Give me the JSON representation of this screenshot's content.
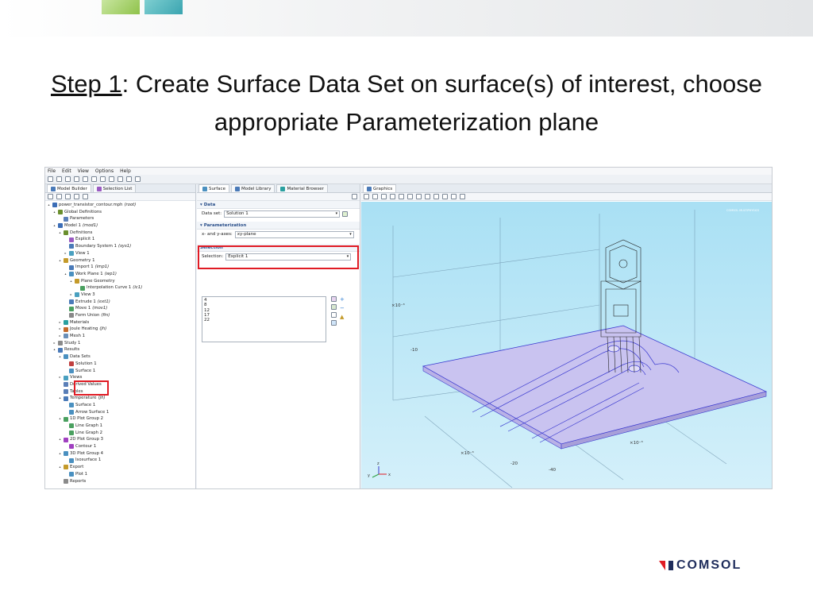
{
  "slide": {
    "title_step": "Step 1",
    "title_rest": ": Create Surface Data Set on surface(s) of interest, choose appropriate Parameterization plane"
  },
  "app": {
    "menu": [
      "File",
      "Edit",
      "View",
      "Options",
      "Help"
    ],
    "left_tabs": [
      "Model Builder",
      "Selection List"
    ],
    "middle_tabs": [
      "Surface",
      "Model Library",
      "Material Browser"
    ],
    "right_tab": "Graphics"
  },
  "tree": [
    {
      "label": "power_transistor_contour.mph",
      "note": "(root)",
      "indent": 0,
      "arrow": "▴",
      "color": "#3b6db6"
    },
    {
      "label": "Global Definitions",
      "note": "",
      "indent": 1,
      "arrow": "▴",
      "color": "#6a8f2d"
    },
    {
      "label": "Parameters",
      "note": "",
      "indent": 2,
      "arrow": "",
      "color": "#5a7fb8"
    },
    {
      "label": "Model 1",
      "note": "(mod1)",
      "indent": 1,
      "arrow": "▴",
      "color": "#3b6db6"
    },
    {
      "label": "Definitions",
      "note": "",
      "indent": 2,
      "arrow": "▴",
      "color": "#6a8f2d"
    },
    {
      "label": "Explicit 1",
      "note": "",
      "indent": 3,
      "arrow": "",
      "color": "#9a5ac2"
    },
    {
      "label": "Boundary System 1",
      "note": "(sys1)",
      "indent": 3,
      "arrow": "",
      "color": "#4a7ab8"
    },
    {
      "label": "View 1",
      "note": "",
      "indent": 3,
      "arrow": "▸",
      "color": "#4aa0c0"
    },
    {
      "label": "Geometry 1",
      "note": "",
      "indent": 2,
      "arrow": "▴",
      "color": "#c49a2a"
    },
    {
      "label": "Import 1",
      "note": "(imp1)",
      "indent": 3,
      "arrow": "",
      "color": "#4a7ab8"
    },
    {
      "label": "Work Plane 1",
      "note": "(wp1)",
      "indent": 3,
      "arrow": "▴",
      "color": "#4a90c0"
    },
    {
      "label": "Plane Geometry",
      "note": "",
      "indent": 4,
      "arrow": "▴",
      "color": "#c49a2a"
    },
    {
      "label": "Interpolation Curve 1",
      "note": "(ic1)",
      "indent": 5,
      "arrow": "",
      "color": "#4aa060"
    },
    {
      "label": "View 3",
      "note": "",
      "indent": 4,
      "arrow": "▸",
      "color": "#4aa0c0"
    },
    {
      "label": "Extrude 1",
      "note": "(ext1)",
      "indent": 3,
      "arrow": "",
      "color": "#4a7ab8"
    },
    {
      "label": "Move 1",
      "note": "(mov1)",
      "indent": 3,
      "arrow": "",
      "color": "#4aa060"
    },
    {
      "label": "Form Union",
      "note": "(fin)",
      "indent": 3,
      "arrow": "",
      "color": "#888888"
    },
    {
      "label": "Materials",
      "note": "",
      "indent": 2,
      "arrow": "▸",
      "color": "#2aa0a0"
    },
    {
      "label": "Joule Heating",
      "note": "(jh)",
      "indent": 2,
      "arrow": "▸",
      "color": "#c46a2a"
    },
    {
      "label": "Mesh 1",
      "note": "",
      "indent": 2,
      "arrow": "▸",
      "color": "#6a8fb8"
    },
    {
      "label": "Study 1",
      "note": "",
      "indent": 1,
      "arrow": "▸",
      "color": "#8a8a8a"
    },
    {
      "label": "Results",
      "note": "",
      "indent": 1,
      "arrow": "▴",
      "color": "#4a7ab8"
    },
    {
      "label": "Data Sets",
      "note": "",
      "indent": 2,
      "arrow": "▴",
      "color": "#4a90c0"
    },
    {
      "label": "Solution 1",
      "note": "",
      "indent": 3,
      "arrow": "",
      "color": "#c04040"
    },
    {
      "label": "Surface 1",
      "note": "",
      "indent": 3,
      "arrow": "",
      "color": "#4a90c0"
    },
    {
      "label": "Views",
      "note": "",
      "indent": 2,
      "arrow": "▸",
      "color": "#4aa0c0"
    },
    {
      "label": "Derived Values",
      "note": "",
      "indent": 2,
      "arrow": "",
      "color": "#5a7fb8"
    },
    {
      "label": "Tables",
      "note": "",
      "indent": 2,
      "arrow": "",
      "color": "#5a7fb8"
    },
    {
      "label": "Temperature",
      "note": "(jh)",
      "indent": 2,
      "arrow": "▴",
      "color": "#4a7ab8"
    },
    {
      "label": "Surface 1",
      "note": "",
      "indent": 3,
      "arrow": "",
      "color": "#4a90c0"
    },
    {
      "label": "Arrow Surface 1",
      "note": "",
      "indent": 3,
      "arrow": "",
      "color": "#4a90c0"
    },
    {
      "label": "1D Plot Group 2",
      "note": "",
      "indent": 2,
      "arrow": "▴",
      "color": "#4aa060"
    },
    {
      "label": "Line Graph 1",
      "note": "",
      "indent": 3,
      "arrow": "",
      "color": "#4aa060"
    },
    {
      "label": "Line Graph 2",
      "note": "",
      "indent": 3,
      "arrow": "",
      "color": "#4aa060"
    },
    {
      "label": "2D Plot Group 3",
      "note": "",
      "indent": 2,
      "arrow": "▴",
      "color": "#a040c0"
    },
    {
      "label": "Contour 1",
      "note": "",
      "indent": 3,
      "arrow": "",
      "color": "#a040c0"
    },
    {
      "label": "3D Plot Group 4",
      "note": "",
      "indent": 2,
      "arrow": "▴",
      "color": "#4a90c0"
    },
    {
      "label": "Isosurface 1",
      "note": "",
      "indent": 3,
      "arrow": "",
      "color": "#4a90c0"
    },
    {
      "label": "Export",
      "note": "",
      "indent": 2,
      "arrow": "▴",
      "color": "#c49a2a"
    },
    {
      "label": "Plot 1",
      "note": "",
      "indent": 3,
      "arrow": "",
      "color": "#4a90c0"
    },
    {
      "label": "Reports",
      "note": "",
      "indent": 2,
      "arrow": "",
      "color": "#8a8a8a"
    }
  ],
  "settings": {
    "data_header": "Data",
    "data_set_label": "Data set:",
    "data_set_value": "Solution 1",
    "param_header": "Parameterization",
    "axes_label": "x- and y-axes:",
    "axes_value": "xy-plane",
    "selection_header": "Selection",
    "selection_label": "Selection:",
    "selection_value": "Explicit 1",
    "selection_items": [
      "4",
      "8",
      "12",
      "17",
      "22"
    ]
  },
  "graphics": {
    "scale_labels": [
      "×10⁻³",
      "×10⁻³",
      "×10⁻³"
    ],
    "tick_labels": [
      "-10",
      "-20",
      "-40"
    ],
    "axis_labels": [
      "y",
      "z",
      "x"
    ],
    "watermark": "COMSOL MULTIPHYSICS"
  },
  "logo": {
    "text": "COMSOL"
  },
  "colors": {
    "highlight": "#e01b24",
    "surface_fill": "#c9c3f0",
    "edge": "#3a3ad0"
  }
}
